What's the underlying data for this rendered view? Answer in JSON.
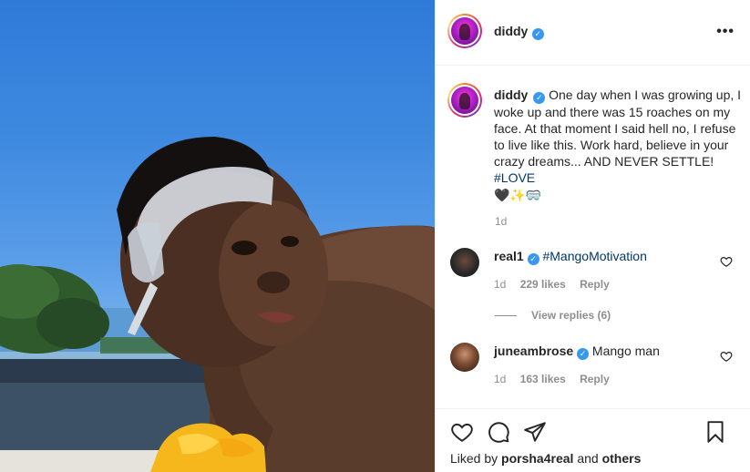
{
  "post": {
    "author": "diddy",
    "verified_mark": "✓",
    "more_label": "•••",
    "caption_text": "One day when I was growing up, I woke up and there was 15 roaches on my face. At that moment I said hell no, I refuse to live like this. Work hard, believe in your crazy dreams... AND NEVER SETTLE!",
    "hashtag": "#LOVE",
    "caption_emojis": "🖤✨🥽",
    "age": "1d"
  },
  "comments": [
    {
      "username": "real1",
      "text": "#MangoMotivation",
      "age": "1d",
      "likes": "229 likes",
      "reply_label": "Reply",
      "view_replies": "View replies (6)"
    },
    {
      "username": "juneambrose",
      "text": "Mango man",
      "age": "1d",
      "likes": "163 likes",
      "reply_label": "Reply"
    }
  ],
  "footer": {
    "liked_prefix": "Liked by",
    "liked_user": "porsha4real",
    "liked_and": "and",
    "liked_others": "others"
  },
  "icons": {
    "like": "heart-icon",
    "comment": "comment-icon",
    "share": "share-icon",
    "save": "bookmark-icon",
    "more": "more-icon"
  },
  "colors": {
    "verified": "#3897f0",
    "hashtag": "#00376b",
    "muted": "#8e8e8e"
  }
}
